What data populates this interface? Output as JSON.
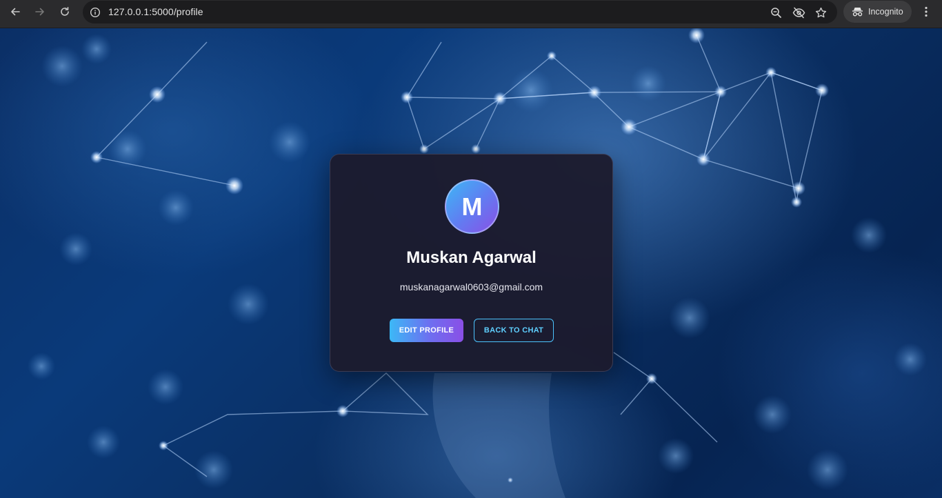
{
  "browser": {
    "url": "127.0.0.1:5000/profile",
    "incognito_label": "Incognito",
    "icons": {
      "back": "arrow-left-icon",
      "forward": "arrow-right-icon",
      "reload": "reload-icon",
      "site_info": "info-icon",
      "zoom": "zoom-icon",
      "tracking": "eye-off-icon",
      "bookmark": "star-icon",
      "incognito": "incognito-icon",
      "menu": "kebab-menu-icon"
    }
  },
  "profile": {
    "avatar_initial": "M",
    "name": "Muskan Agarwal",
    "email": "muskanagarwal0603@gmail.com",
    "edit_button": "EDIT PROFILE",
    "back_button": "BACK TO CHAT"
  },
  "colors": {
    "accent_cyan": "#3cb8f6",
    "accent_purple": "#8a4fe6",
    "card_bg": "#1c1b2e",
    "back_button_text": "#5fd0ff"
  }
}
